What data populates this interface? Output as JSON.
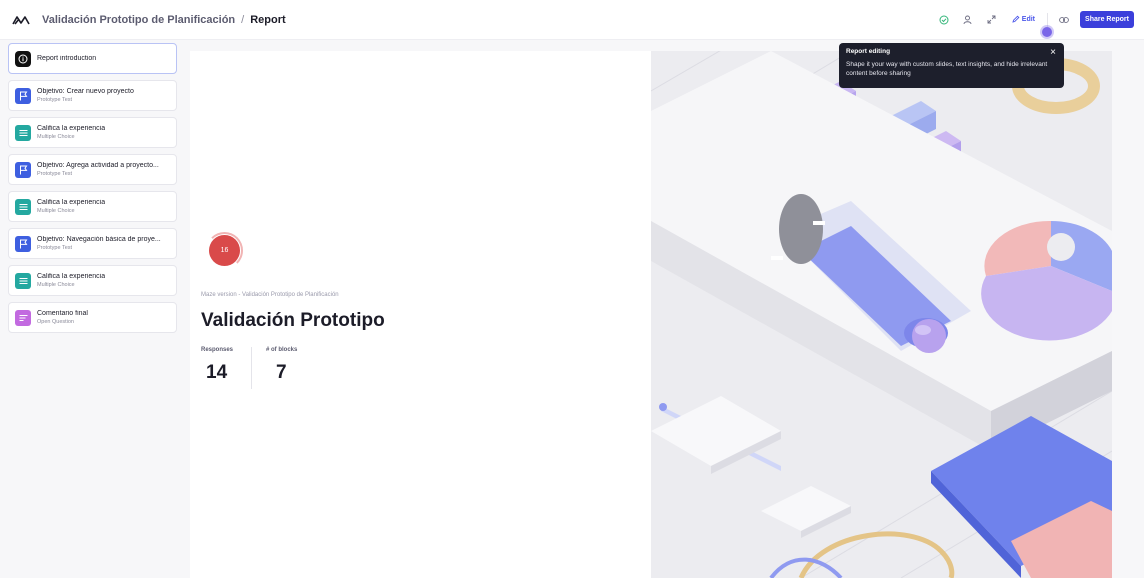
{
  "header": {
    "project_title": "Validación Prototipo de Planificación",
    "separator": "/",
    "current_page": "Report",
    "edit_label": "Edit",
    "share_label": "Share Report"
  },
  "sidebar": {
    "items": [
      {
        "title": "Report introduction",
        "subtitle": "",
        "type": "intro"
      },
      {
        "title": "Objetivo: Crear nuevo proyecto",
        "subtitle": "Prototype Test",
        "type": "flag"
      },
      {
        "title": "Califica la experiencia",
        "subtitle": "Multiple Choice",
        "type": "mc"
      },
      {
        "title": "Objetivo: Agrega actividad a proyecto...",
        "subtitle": "Prototype Test",
        "type": "flag"
      },
      {
        "title": "Califica la experiencia",
        "subtitle": "Multiple Choice",
        "type": "mc"
      },
      {
        "title": "Objetivo: Navegación básica de proye...",
        "subtitle": "Prototype Test",
        "type": "flag"
      },
      {
        "title": "Califica la experiencia",
        "subtitle": "Multiple Choice",
        "type": "mc"
      },
      {
        "title": "Comentario final",
        "subtitle": "Open Question",
        "type": "oq"
      }
    ]
  },
  "slide": {
    "badge_value": "16",
    "maze_version": "Maze version - Validación Prototipo de Planificación",
    "title": "Validación Prototipo",
    "stats": [
      {
        "label": "Responses",
        "value": "14"
      },
      {
        "label": "# of blocks",
        "value": "7"
      }
    ]
  },
  "tooltip": {
    "title": "Report editing",
    "body": "Shape it your way with custom slides, text insights, and hide irrelevant content before sharing",
    "close": "×"
  },
  "colors": {
    "accent": "#3b3fdb",
    "flag_icon": "#3e5fe0",
    "mc_icon": "#24a8a0",
    "oq_icon": "#c26ae0",
    "badge": "#d94a4a"
  }
}
